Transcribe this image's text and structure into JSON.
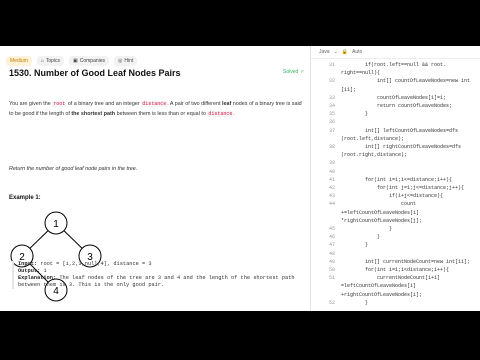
{
  "tabs": [
    "Medium",
    "Topics",
    "Companies",
    "Hint"
  ],
  "title": "1530. Number of Good Leaf Nodes Pairs",
  "solved": "Solved",
  "desc": {
    "p1a": "You are given the ",
    "code_root": "root",
    "p1b": " of a binary tree and an integer ",
    "code_distance": "distance",
    "p1c": ". A pair of two different ",
    "leaf": "leaf",
    "p1d": " nodes of a binary tree is said to be good if the length of ",
    "shortest": "the shortest path",
    "p1e": " between them is less than or equal to ",
    "p1f": "."
  },
  "desc2": "Return the number of good leaf node pairs in the tree.",
  "example_label": "Example 1:",
  "tree_nodes": [
    "1",
    "2",
    "3",
    "4"
  ],
  "example": {
    "input_label": "Input:",
    "input": "root = [1,2,3,null,4], distance = 3",
    "output_label": "Output:",
    "output": "1",
    "expl_label": "Explanation:",
    "expl1": "The leaf nodes of the tree are 3 and 4 and the length of the shortest path",
    "expl2": "between them is 3. This is the only good pair."
  },
  "editor": {
    "lang": "Java",
    "mode": "Auto"
  },
  "code_lines": [
    {
      "n": "31",
      "t": "        if(root.left==null && root."
    },
    {
      "n": "",
      "t": "right==null){"
    },
    {
      "n": "32",
      "t": "            int[] countOfLeaveNodes=new int"
    },
    {
      "n": "",
      "t": "[11];"
    },
    {
      "n": "33",
      "t": "            countOfLeaveNodes[1]=1;"
    },
    {
      "n": "34",
      "t": "            return countOfLeaveNodes;"
    },
    {
      "n": "35",
      "t": "        }"
    },
    {
      "n": "36",
      "t": ""
    },
    {
      "n": "37",
      "t": "        int[] leftCountOfLeaveNodes=dfs"
    },
    {
      "n": "",
      "t": "(root.left,distance);"
    },
    {
      "n": "38",
      "t": "        int[] rightCountOfLeaveNodes=dfs"
    },
    {
      "n": "",
      "t": "(root.right,distance);"
    },
    {
      "n": "39",
      "t": ""
    },
    {
      "n": "40",
      "t": ""
    },
    {
      "n": "41",
      "t": "        for(int i=1;i<=distance;i++){"
    },
    {
      "n": "42",
      "t": "            for(int j=1;j<=distance;j++){"
    },
    {
      "n": "43",
      "t": "                if(i+j<=distance){"
    },
    {
      "n": "44",
      "t": "                    count"
    },
    {
      "n": "",
      "t": "+=leftCountOfLeaveNodes[i]"
    },
    {
      "n": "",
      "t": "*rightCountOfLeaveNodes[j];"
    },
    {
      "n": "45",
      "t": "                }"
    },
    {
      "n": "46",
      "t": "            }"
    },
    {
      "n": "47",
      "t": "        }"
    },
    {
      "n": "48",
      "t": ""
    },
    {
      "n": "49",
      "t": "        int[] currentNodeCount=new int[11];"
    },
    {
      "n": "50",
      "t": "        for(int i=1;i<distance;i++){"
    },
    {
      "n": "51",
      "t": "            currentNodeCount[i+1]"
    },
    {
      "n": "",
      "t": "=leftCountOfLeaveNodes[i]"
    },
    {
      "n": "",
      "t": "+rightCountOfLeaveNodes[i];"
    },
    {
      "n": "52",
      "t": "        }"
    }
  ]
}
